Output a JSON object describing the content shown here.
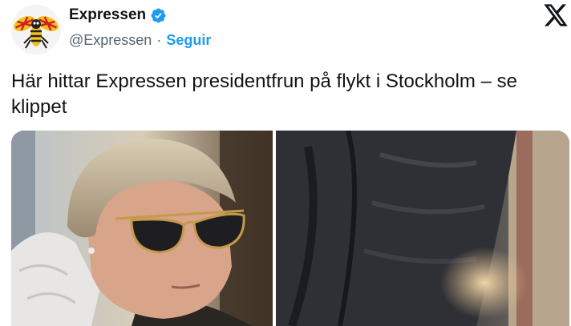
{
  "account": {
    "name": "Expressen",
    "handle": "@Expressen",
    "separator": "·",
    "follow_label": "Seguir",
    "verified": true,
    "avatar_icon": "expressen-wasp-logo-icon",
    "brand_color": "#1d9bf0"
  },
  "platform_logo": "x-logo-icon",
  "tweet": {
    "text": "Här hittar Expressen presidentfrun på flykt i Stockholm – se klippet"
  },
  "media": {
    "images": [
      {
        "name": "photo-woman-sunglasses"
      },
      {
        "name": "photo-dark-jacket-closeup"
      }
    ]
  }
}
